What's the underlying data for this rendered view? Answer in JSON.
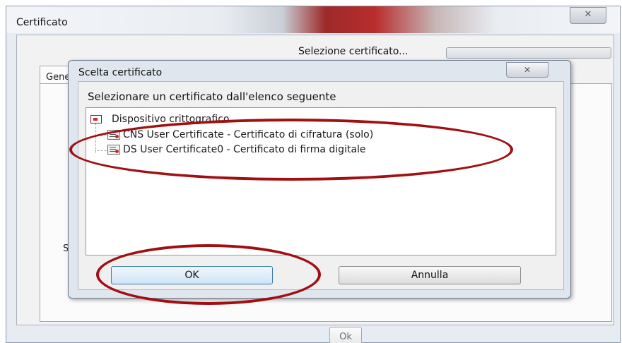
{
  "outer_window": {
    "title": "Certificato",
    "close_label": "✕",
    "progress_label": "Selezione certificato...",
    "tab_label": "Gene",
    "serial_label": "Seri",
    "ok_label": "Ok"
  },
  "dialog": {
    "title": "Scelta certificato",
    "close_label": "✕",
    "instruction": "Selezionare un certificato dall'elenco seguente",
    "tree": {
      "root": {
        "label": "Dispositivo crittografico",
        "icon": "device-icon"
      },
      "children": [
        {
          "label": "CNS User Certificate - Certificato di cifratura (solo)",
          "icon": "certificate-icon"
        },
        {
          "label": "DS User Certificate0 - Certificato di firma digitale",
          "icon": "certificate-icon"
        }
      ]
    },
    "ok_label": "OK",
    "cancel_label": "Annulla"
  },
  "colors": {
    "annotation_red": "#a10f12",
    "dialog_bg": "#dfe6ee",
    "ok_button_border": "#3c7fb1"
  }
}
